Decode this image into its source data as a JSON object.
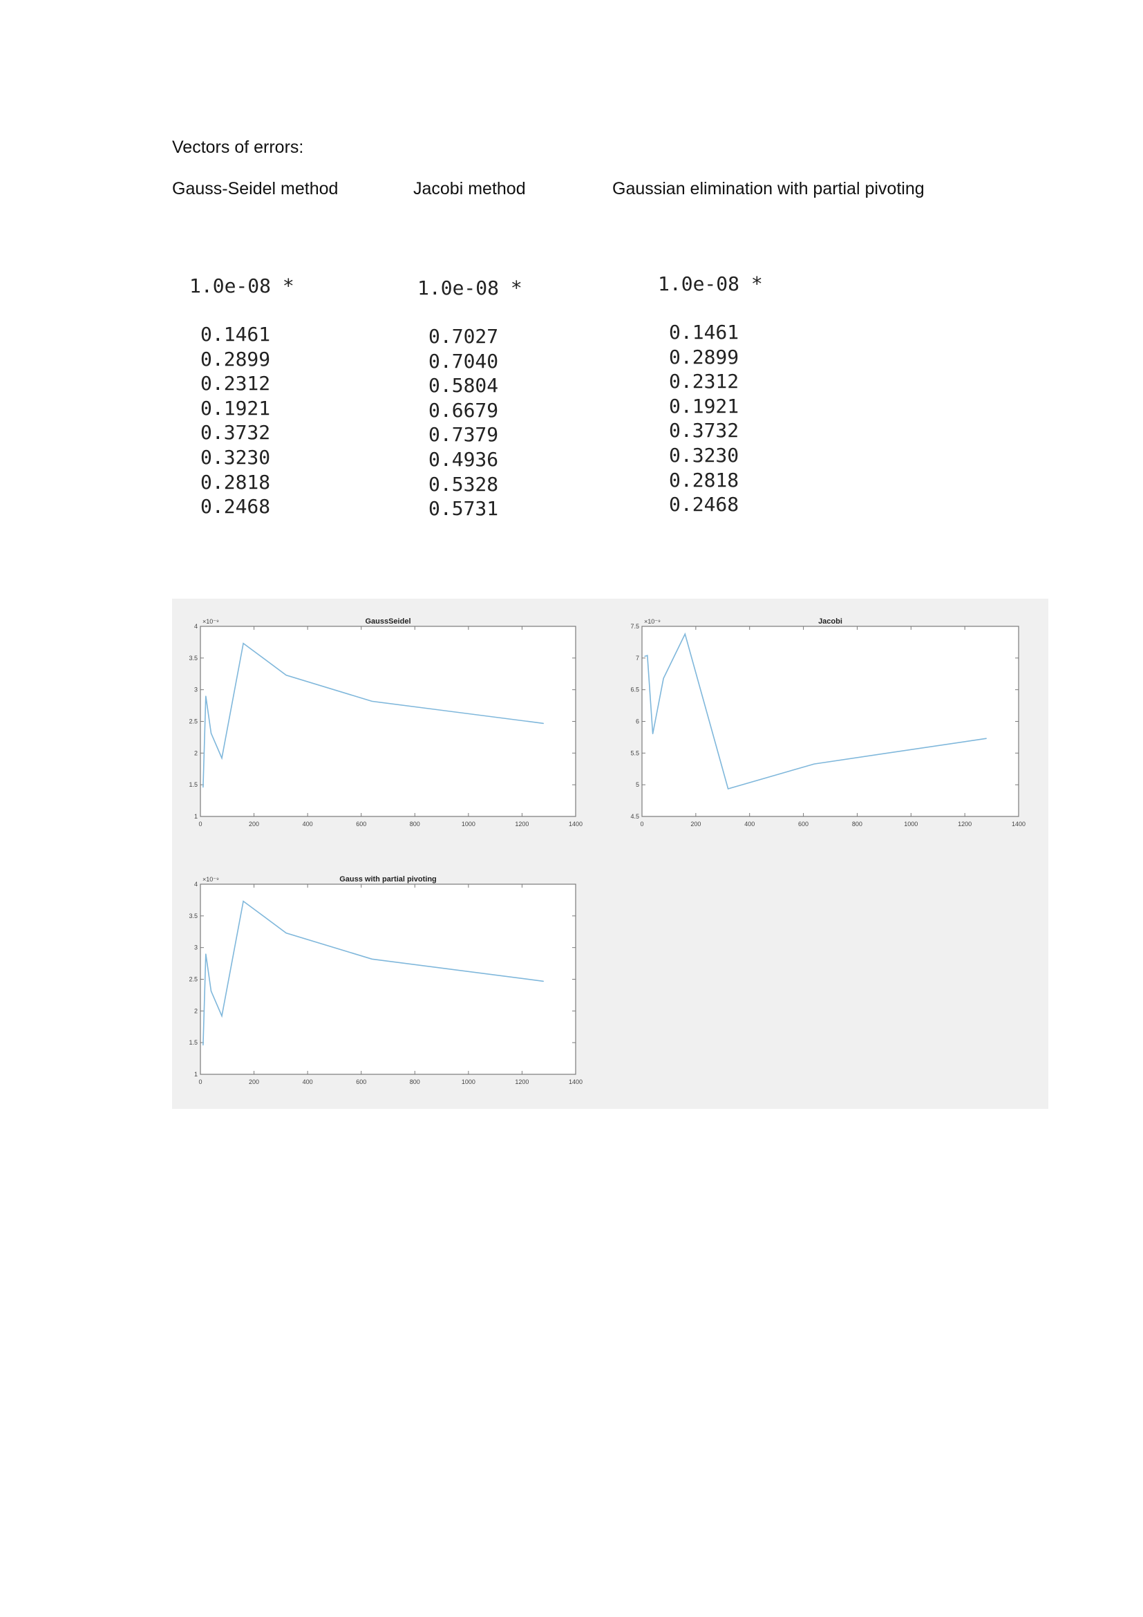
{
  "page": {
    "intro": "Vectors of errors:",
    "headers": {
      "gauss_seidel": "Gauss-Seidel method",
      "jacobi": "Jacobi method",
      "gaussian_elim": "Gaussian elimination with partial pivoting"
    }
  },
  "vectors": [
    {
      "name": "gauss_seidel",
      "factor": "1.0e-08 *",
      "values": [
        "0.1461",
        "0.2899",
        "0.2312",
        "0.1921",
        "0.3732",
        "0.3230",
        "0.2818",
        "0.2468"
      ]
    },
    {
      "name": "jacobi",
      "factor": "1.0e-08 *",
      "values": [
        "0.7027",
        "0.7040",
        "0.5804",
        "0.6679",
        "0.7379",
        "0.4936",
        "0.5328",
        "0.5731"
      ]
    },
    {
      "name": "gaussian_elim",
      "factor": "1.0e-08 *",
      "values": [
        "0.1461",
        "0.2899",
        "0.2312",
        "0.1921",
        "0.3732",
        "0.3230",
        "0.2818",
        "0.2468"
      ]
    }
  ],
  "colors": {
    "line": "#7fb7db",
    "plot_background": "#f0f0f0"
  },
  "chart_data": [
    {
      "type": "line",
      "title": "GaussSeidel",
      "exponent_label": "×10⁻⁹",
      "xlim": [
        0,
        1400
      ],
      "ylim": [
        1,
        4
      ],
      "xticks": [
        0,
        200,
        400,
        600,
        800,
        1000,
        1200,
        1400
      ],
      "yticks": [
        1,
        1.5,
        2,
        2.5,
        3,
        3.5,
        4
      ],
      "x": [
        10,
        20,
        40,
        80,
        160,
        320,
        640,
        1280
      ],
      "y": [
        1.461,
        2.899,
        2.312,
        1.921,
        3.732,
        3.23,
        2.818,
        2.468
      ]
    },
    {
      "type": "line",
      "title": "Jacobi",
      "exponent_label": "×10⁻⁹",
      "xlim": [
        0,
        1400
      ],
      "ylim": [
        4.5,
        7.5
      ],
      "xticks": [
        0,
        200,
        400,
        600,
        800,
        1000,
        1200,
        1400
      ],
      "yticks": [
        4.5,
        5,
        5.5,
        6,
        6.5,
        7,
        7.5
      ],
      "x": [
        10,
        20,
        40,
        80,
        160,
        320,
        640,
        1280
      ],
      "y": [
        7.027,
        7.04,
        5.804,
        6.679,
        7.379,
        4.936,
        5.328,
        5.731
      ]
    },
    {
      "type": "line",
      "title": "Gauss with partial pivoting",
      "exponent_label": "×10⁻⁹",
      "xlim": [
        0,
        1400
      ],
      "ylim": [
        1,
        4
      ],
      "xticks": [
        0,
        200,
        400,
        600,
        800,
        1000,
        1200,
        1400
      ],
      "yticks": [
        1,
        1.5,
        2,
        2.5,
        3,
        3.5,
        4
      ],
      "x": [
        10,
        20,
        40,
        80,
        160,
        320,
        640,
        1280
      ],
      "y": [
        1.461,
        2.899,
        2.312,
        1.921,
        3.732,
        3.23,
        2.818,
        2.468
      ]
    }
  ]
}
